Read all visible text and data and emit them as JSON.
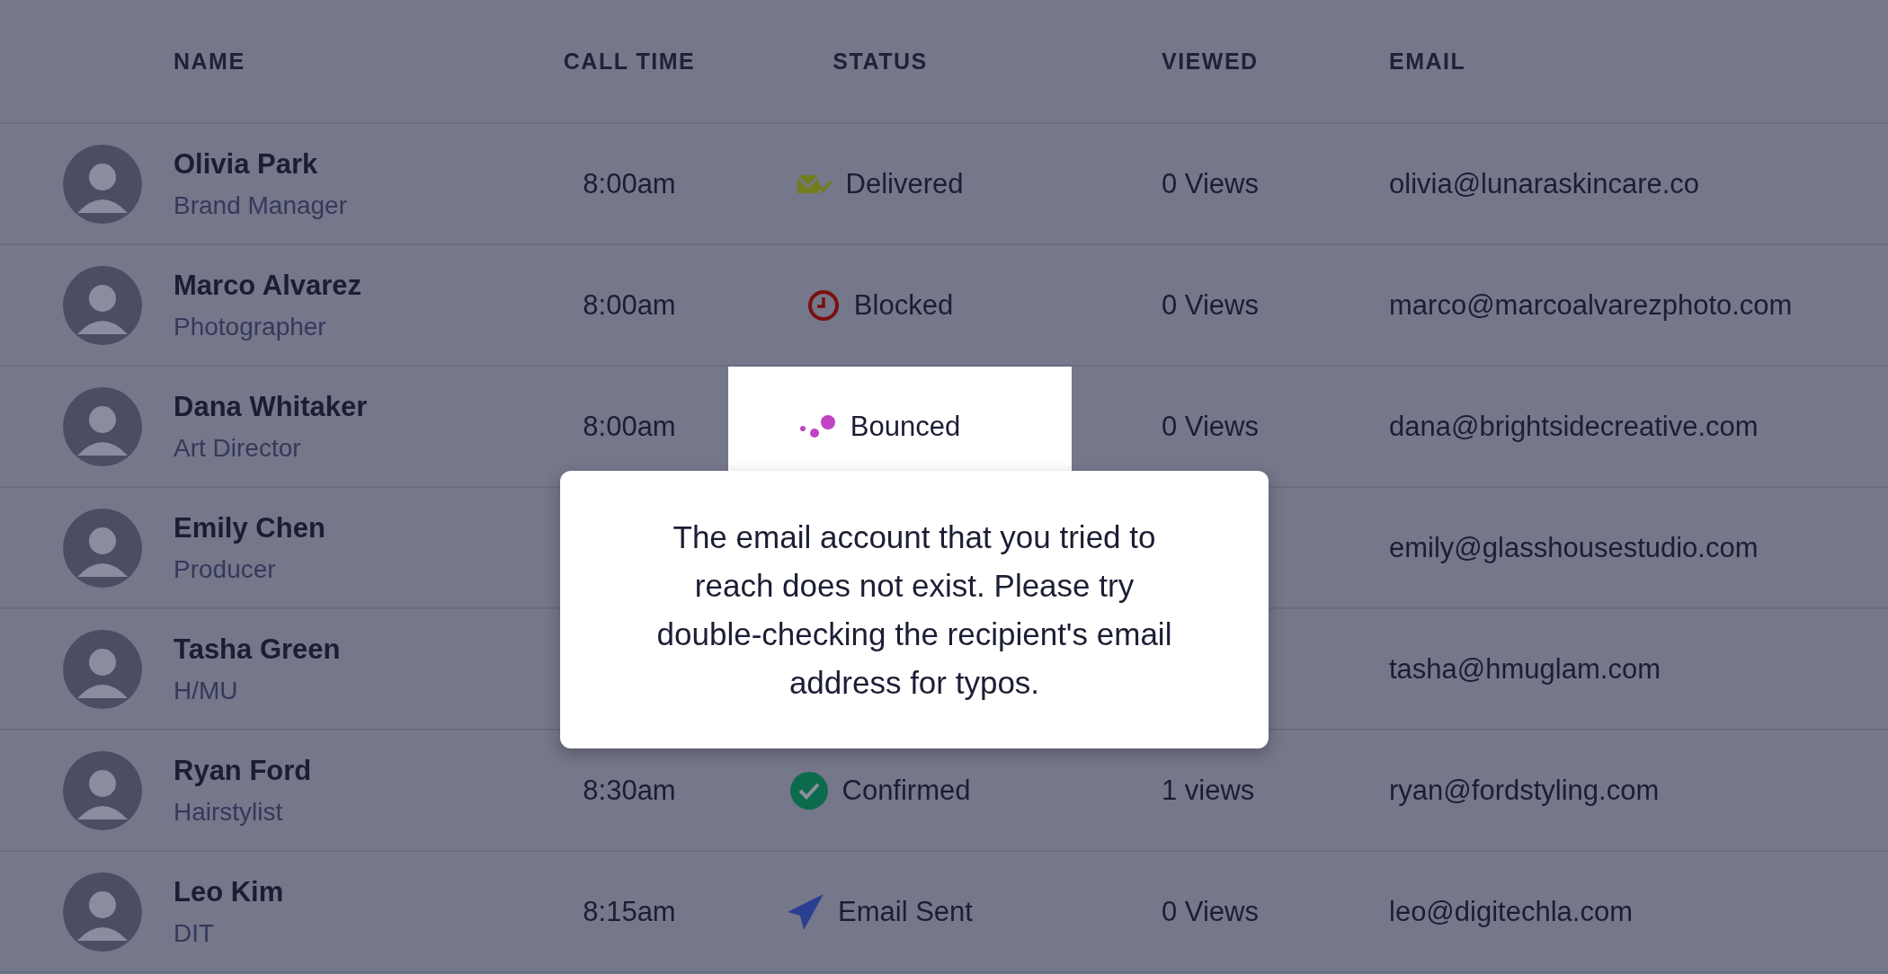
{
  "columns": [
    "NAME",
    "CALL TIME",
    "STATUS",
    "VIEWED",
    "EMAIL"
  ],
  "rows": [
    {
      "name": "Olivia Park",
      "role": "Brand Manager",
      "call_time": "8:00am",
      "status": {
        "kind": "delivered",
        "label": "Delivered"
      },
      "highlighted": false,
      "views": "0 Views",
      "email": "olivia@lunaraskincare.co"
    },
    {
      "name": "Marco Alvarez",
      "role": "Photographer",
      "call_time": "8:00am",
      "status": {
        "kind": "blocked",
        "label": "Blocked"
      },
      "highlighted": false,
      "views": "0 Views",
      "email": "marco@marcoalvarezphoto.com"
    },
    {
      "name": "Dana Whitaker",
      "role": "Art Director",
      "call_time": "8:00am",
      "status": {
        "kind": "bounced",
        "label": "Bounced"
      },
      "highlighted": true,
      "views": "0 Views",
      "email": "dana@brightsidecreative.com"
    },
    {
      "name": "Emily Chen",
      "role": "Producer",
      "email": "emily@glasshousestudio.com"
    },
    {
      "name": "Tasha Green",
      "role": "H/MU",
      "email": "tasha@hmuglam.com"
    },
    {
      "name": "Ryan Ford",
      "role": "Hairstylist",
      "call_time": "8:30am",
      "status": {
        "kind": "confirmed",
        "label": "Confirmed"
      },
      "highlighted": false,
      "views": "1 views",
      "email": "ryan@fordstyling.com"
    },
    {
      "name": "Leo Kim",
      "role": "DIT",
      "call_time": "8:15am",
      "status": {
        "kind": "sent",
        "label": "Email Sent"
      },
      "highlighted": false,
      "views": "0 Views",
      "email": "leo@digitechla.com"
    }
  ],
  "tooltip": {
    "text": "The email account that you tried to reach does not exist. Please try double-checking the recipient's email address for typos."
  }
}
